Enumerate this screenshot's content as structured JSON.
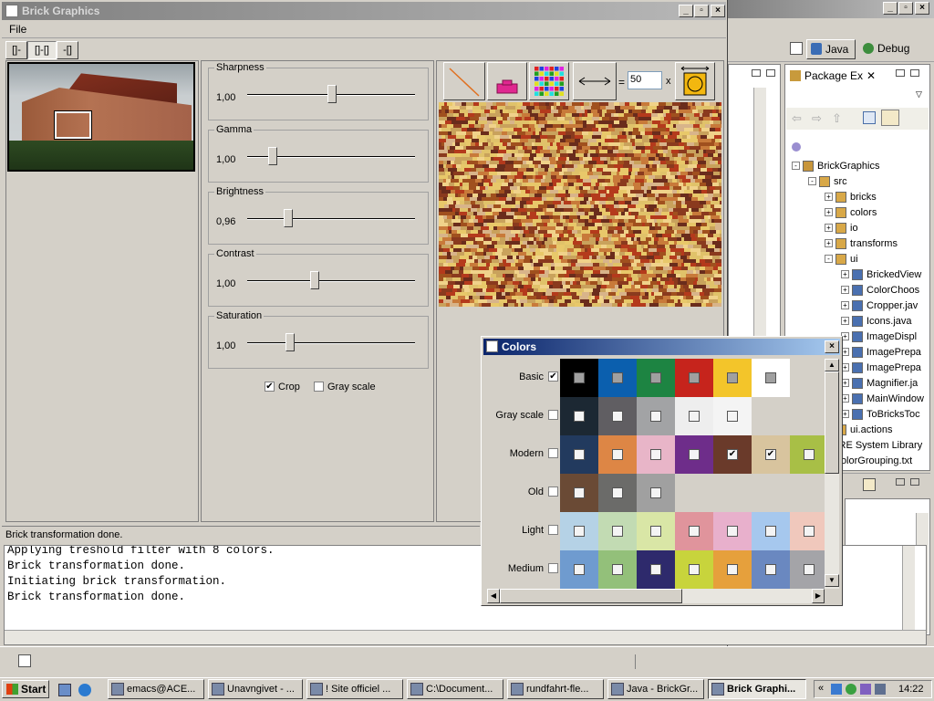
{
  "main_window": {
    "title": "Brick Graphics",
    "menu_file": "File",
    "layout_tabs": [
      "[]-",
      "[]-[]",
      "-[]"
    ],
    "sliders": [
      {
        "label": "Sharpness",
        "value": "1,00",
        "level": 0.5
      },
      {
        "label": "Gamma",
        "value": "1,00",
        "level": 0.15
      },
      {
        "label": "Brightness",
        "value": "0,96",
        "level": 0.24
      },
      {
        "label": "Contrast",
        "value": "1,00",
        "level": 0.4
      },
      {
        "label": "Saturation",
        "value": "1,00",
        "level": 0.25
      }
    ],
    "crop": {
      "label": "Crop",
      "checked": true
    },
    "gray": {
      "label": "Gray scale",
      "checked": false
    },
    "width_eq": "=",
    "width_value": "50",
    "width_x": "x",
    "status": "Brick transformation done."
  },
  "console": {
    "lines": [
      "Applying treshold filter with 8 colors.",
      "Brick transformation done.",
      "Initiating brick transformation.",
      "Brick transformation done."
    ]
  },
  "colors_dialog": {
    "title": "Colors",
    "rows": [
      {
        "label": "Basic",
        "checked": true,
        "cells": [
          {
            "c": "#000000",
            "k": "g"
          },
          {
            "c": "#0b5fae",
            "k": "g"
          },
          {
            "c": "#1d8442",
            "k": "g"
          },
          {
            "c": "#c6241c",
            "k": "g"
          },
          {
            "c": "#f3c52a",
            "k": "g"
          },
          {
            "c": "#ffffff",
            "k": "g"
          }
        ]
      },
      {
        "label": "Gray scale",
        "checked": false,
        "cells": [
          {
            "c": "#1c2833",
            "k": ""
          },
          {
            "c": "#605e62",
            "k": ""
          },
          {
            "c": "#a2a3a5",
            "k": ""
          },
          {
            "c": "#eeeeee",
            "k": ""
          },
          {
            "c": "#f4f4f4",
            "k": ""
          }
        ]
      },
      {
        "label": "Modern",
        "checked": false,
        "cells": [
          {
            "c": "#223a5e",
            "k": ""
          },
          {
            "c": "#dd8645",
            "k": ""
          },
          {
            "c": "#e8b5c8",
            "k": ""
          },
          {
            "c": "#6e2d8a",
            "k": ""
          },
          {
            "c": "#6a3a2a",
            "k": "x"
          },
          {
            "c": "#d8c49e",
            "k": "x"
          },
          {
            "c": "#a8bf46",
            "k": ""
          }
        ]
      },
      {
        "label": "Old",
        "checked": false,
        "cells": [
          {
            "c": "#6a4a35",
            "k": ""
          },
          {
            "c": "#6b6b69",
            "k": ""
          },
          {
            "c": "#a0a0a0",
            "k": ""
          }
        ]
      },
      {
        "label": "Light",
        "checked": false,
        "cells": [
          {
            "c": "#b5d2e6",
            "k": ""
          },
          {
            "c": "#c2dbb3",
            "k": ""
          },
          {
            "c": "#d9e6a6",
            "k": ""
          },
          {
            "c": "#e0949c",
            "k": ""
          },
          {
            "c": "#e8b0cc",
            "k": ""
          },
          {
            "c": "#a6c8ee",
            "k": ""
          },
          {
            "c": "#f0c8bc",
            "k": ""
          }
        ]
      },
      {
        "label": "Medium",
        "checked": false,
        "cells": [
          {
            "c": "#6f9bcf",
            "k": ""
          },
          {
            "c": "#93c07a",
            "k": ""
          },
          {
            "c": "#2e2a6c",
            "k": ""
          },
          {
            "c": "#c8d43c",
            "k": ""
          },
          {
            "c": "#e6a03c",
            "k": ""
          },
          {
            "c": "#6a88c0",
            "k": ""
          },
          {
            "c": "#a4a4a8",
            "k": ""
          }
        ]
      }
    ]
  },
  "eclipse": {
    "perspectives": {
      "java": "Java",
      "debug": "Debug"
    },
    "package_tab": "Package Ex",
    "tree": [
      {
        "t": "BrickGraphics",
        "lv": 0,
        "ic": "proj",
        "exp": "-"
      },
      {
        "t": "src",
        "lv": 1,
        "ic": "src",
        "exp": "-"
      },
      {
        "t": "bricks",
        "lv": 2,
        "ic": "pkg",
        "exp": "+"
      },
      {
        "t": "colors",
        "lv": 2,
        "ic": "pkg",
        "exp": "+"
      },
      {
        "t": "io",
        "lv": 2,
        "ic": "pkg",
        "exp": "+"
      },
      {
        "t": "transforms",
        "lv": 2,
        "ic": "pkg",
        "exp": "+"
      },
      {
        "t": "ui",
        "lv": 2,
        "ic": "pkg",
        "exp": "-"
      },
      {
        "t": "BrickedView",
        "lv": 3,
        "ic": "java",
        "exp": "+"
      },
      {
        "t": "ColorChoos",
        "lv": 3,
        "ic": "java",
        "exp": "+"
      },
      {
        "t": "Cropper.jav",
        "lv": 3,
        "ic": "java",
        "exp": "+"
      },
      {
        "t": "Icons.java",
        "lv": 3,
        "ic": "java",
        "exp": "+"
      },
      {
        "t": "ImageDispl",
        "lv": 3,
        "ic": "java",
        "exp": "+"
      },
      {
        "t": "ImagePrepa",
        "lv": 3,
        "ic": "java",
        "exp": "+"
      },
      {
        "t": "ImagePrepa",
        "lv": 3,
        "ic": "java",
        "exp": "+"
      },
      {
        "t": "Magnifier.ja",
        "lv": 3,
        "ic": "java",
        "exp": "+"
      },
      {
        "t": "MainWindow",
        "lv": 3,
        "ic": "java",
        "exp": "+"
      },
      {
        "t": "ToBricksToc",
        "lv": 3,
        "ic": "java",
        "exp": "+"
      },
      {
        "t": "ui.actions",
        "lv": 2,
        "ic": "pkg",
        "exp": ""
      },
      {
        "t": "JRE System Library",
        "lv": 1,
        "ic": "lib",
        "exp": ""
      },
      {
        "t": "ColorGrouping.txt",
        "lv": 1,
        "ic": "file",
        "exp": ""
      }
    ]
  },
  "taskbar": {
    "start": "Start",
    "tasks": [
      "emacs@ACE...",
      "Unavngivet - ...",
      "! Site officiel ...",
      "C:\\Document...",
      "rundfahrt-fle...",
      "Java - BrickGr...",
      "Brick Graphi..."
    ],
    "clock": "14:22"
  },
  "colors_accent": {
    "title_bar": "#0a246a",
    "title_bar_end": "#a6caf0",
    "inactive_title": "#808080"
  }
}
